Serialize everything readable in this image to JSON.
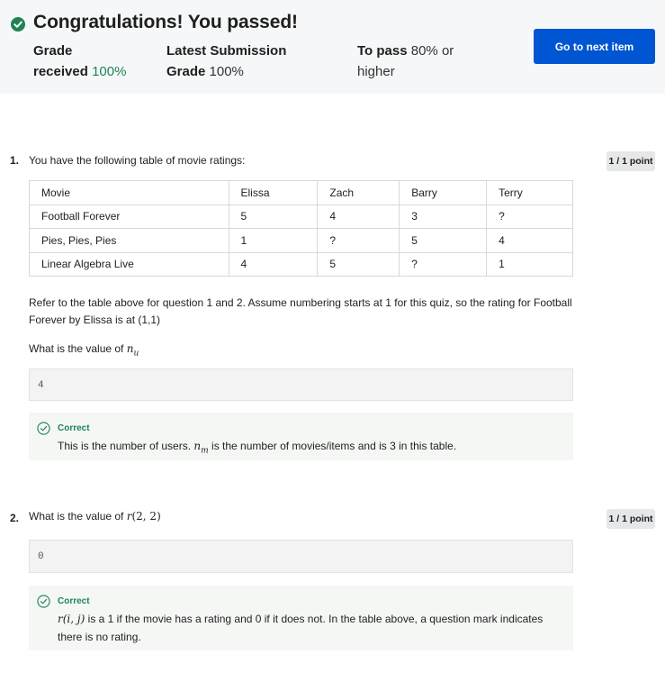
{
  "banner": {
    "title": "Congratulations! You passed!",
    "grade_label_1": "Grade",
    "grade_label_2": "received",
    "grade_value": "100%",
    "latest_label_1": "Latest Submission",
    "latest_label_2": "Grade",
    "latest_value": "100%",
    "pass_label": "To pass",
    "pass_value_1": "80% or",
    "pass_value_2": "higher",
    "next_button": "Go to next item",
    "colors": {
      "success": "#1f8354",
      "primary_button": "#0056d2"
    }
  },
  "questions": [
    {
      "number": "1.",
      "prompt": "You have the following table of movie ratings:",
      "points": "1 / 1 point",
      "table": {
        "headers": [
          "Movie",
          "Elissa",
          "Zach",
          "Barry",
          "Terry"
        ],
        "rows": [
          [
            "Football Forever",
            "5",
            "4",
            "3",
            "?"
          ],
          [
            "Pies, Pies, Pies",
            "1",
            "?",
            "5",
            "4"
          ],
          [
            "Linear Algebra Live",
            "4",
            "5",
            "?",
            "1"
          ]
        ]
      },
      "context_1": "Refer to the table above for question 1 and 2. Assume numbering starts at 1 for this quiz, so the rating for Football",
      "context_2": "Forever by Elissa is at (1,1)",
      "question_prefix": "What is the value of",
      "math_var": "n",
      "math_sub": "u",
      "answer": "4",
      "feedback_label": "Correct",
      "feedback_pre": "This is the number of users.",
      "feedback_var": "n",
      "feedback_sub": "m",
      "feedback_post": "is the number of movies/items and is 3 in this table."
    },
    {
      "number": "2.",
      "prompt_prefix": "What is the value of",
      "math_fn": "r",
      "math_args": "(2, 2)",
      "points": "1 / 1 point",
      "answer": "0",
      "feedback_label": "Correct",
      "feedback_fn": "r",
      "feedback_args": "(i, j)",
      "feedback_line_1": "is a 1 if the movie has a rating and 0 if it does not. In the table above, a question mark indicates",
      "feedback_line_2": "there is no rating."
    }
  ]
}
